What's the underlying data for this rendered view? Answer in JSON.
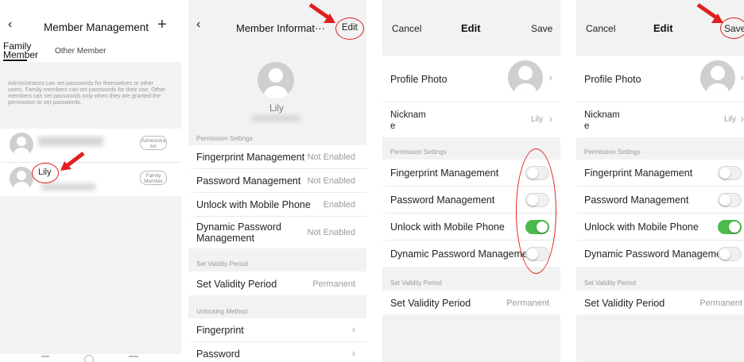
{
  "panel1": {
    "title": "Member Management",
    "back_icon": "chevron-left-icon",
    "add_icon": "plus-icon",
    "tab_family": "Family Member",
    "tab_family_line1": "Family",
    "tab_family_line2": "Member",
    "tab_other": "Other Member",
    "notice": "Administrators can set passwords for themselves or other users. Family members can set passwords for their use. Other members can set passwords only when they are granted the permission to set passwords.",
    "members": [
      {
        "name": "",
        "badge_line1": "Administra",
        "badge_line2": "tor"
      },
      {
        "name": "Lily",
        "badge_line1": "Family",
        "badge_line2": "Member"
      }
    ]
  },
  "panel2": {
    "title": "Member Informat···",
    "edit_label": "Edit",
    "name": "Lily",
    "permission_section": "Permission Settings",
    "permissions": [
      {
        "label": "Fingerprint Management",
        "value": "Not Enabled"
      },
      {
        "label": "Password Management",
        "value": "Not Enabled"
      },
      {
        "label": "Unlock with Mobile Phone",
        "value": "Enabled"
      },
      {
        "label_line1": "Dynamic Password",
        "label_line2": "Management",
        "value": "Not Enabled"
      }
    ],
    "validity_section": "Set Validity Period",
    "validity_label": "Set Validity Period",
    "validity_value": "Permanent",
    "unlocking_section": "Unlocking Method",
    "methods": [
      "Fingerprint",
      "Password"
    ]
  },
  "panel3": {
    "cancel_label": "Cancel",
    "title": "Edit",
    "save_label": "Save",
    "profile_photo_label": "Profile Photo",
    "nickname_line1": "Nicknam",
    "nickname_line2": "e",
    "nickname_value": "Lily",
    "permission_section": "Permission Settings",
    "permissions": [
      {
        "label": "Fingerprint Management",
        "enabled": false
      },
      {
        "label": "Password Management",
        "enabled": false
      },
      {
        "label": "Unlock with Mobile Phone",
        "enabled": true
      },
      {
        "label": "Dynamic Password Management",
        "enabled": false
      }
    ],
    "validity_section": "Set Validity Period",
    "validity_label": "Set Validity Period",
    "validity_value": "Permanent"
  },
  "panel4": {
    "cancel_label": "Cancel",
    "title": "Edit",
    "save_label": "Save",
    "profile_photo_label": "Profile Photo",
    "nickname_line1": "Nicknam",
    "nickname_line2": "e",
    "nickname_value": "Lily",
    "permission_section": "Permission Settings",
    "permissions": [
      {
        "label": "Fingerprint Management",
        "enabled": false
      },
      {
        "label": "Password Management",
        "enabled": false
      },
      {
        "label": "Unlock with Mobile Phone",
        "enabled": true
      },
      {
        "label": "Dynamic Password Management",
        "enabled": false
      }
    ],
    "validity_section": "Set Validity Period",
    "validity_label": "Set Validity Period",
    "validity_value": "Permanent"
  },
  "colors": {
    "annotation_red": "#e02020",
    "toggle_on": "#4cba4c",
    "background": "#f2f2f2"
  }
}
